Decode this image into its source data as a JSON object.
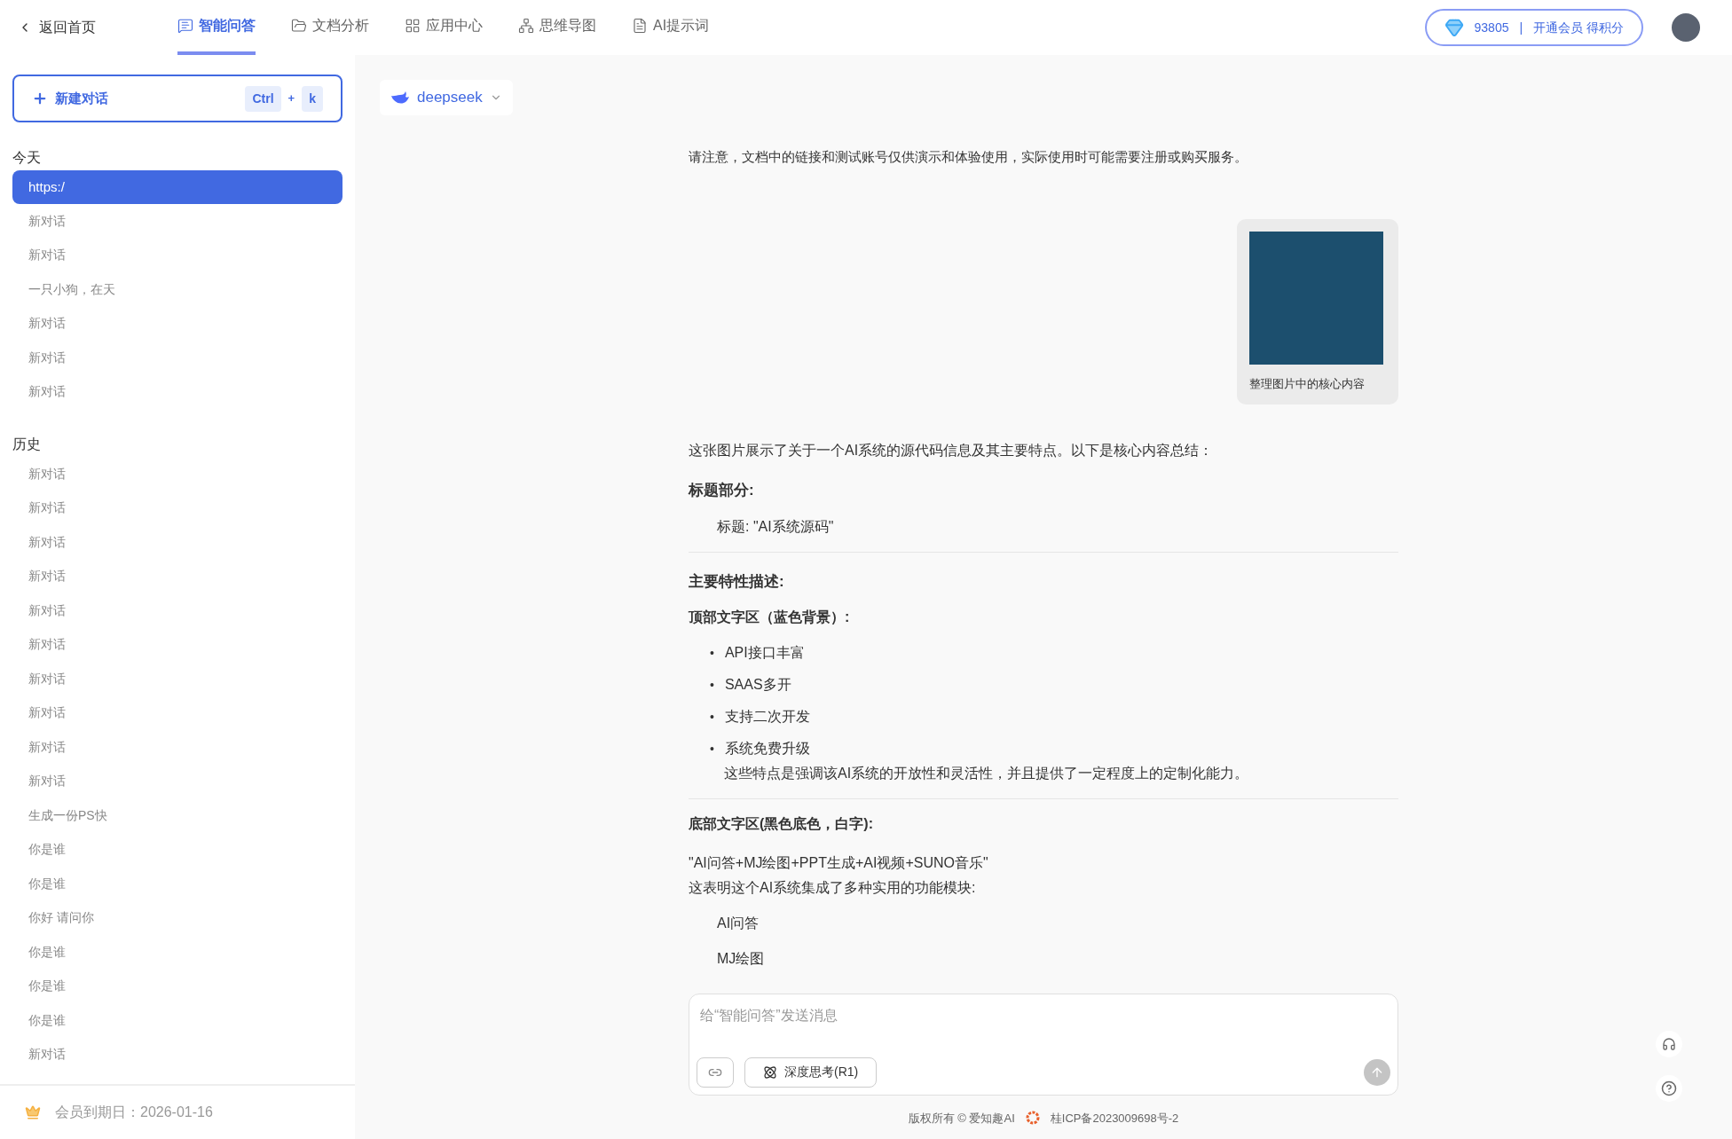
{
  "topbar": {
    "back": "返回首页",
    "tabs": [
      {
        "label": "智能问答",
        "selected": true
      },
      {
        "label": "文档分析",
        "selected": false
      },
      {
        "label": "应用中心",
        "selected": false
      },
      {
        "label": "思维导图",
        "selected": false
      },
      {
        "label": "AI提示词",
        "selected": false
      }
    ],
    "points": "93805",
    "points_separator": "|",
    "member_cta": "开通会员 得积分"
  },
  "sidebar": {
    "new_chat": {
      "label": "新建对话",
      "keys": [
        "Ctrl",
        "+",
        "k"
      ]
    },
    "groups": [
      {
        "title": "今天",
        "items": [
          {
            "label": "https:/",
            "selected": true
          },
          {
            "label": "新对话",
            "selected": false
          },
          {
            "label": "新对话",
            "selected": false
          },
          {
            "label": "一只小狗，在天",
            "selected": false
          },
          {
            "label": "新对话",
            "selected": false
          },
          {
            "label": "新对话",
            "selected": false
          },
          {
            "label": "新对话",
            "selected": false
          }
        ]
      },
      {
        "title": "历史",
        "items": [
          {
            "label": "新对话",
            "selected": false
          },
          {
            "label": "新对话",
            "selected": false
          },
          {
            "label": "新对话",
            "selected": false
          },
          {
            "label": "新对话",
            "selected": false
          },
          {
            "label": "新对话",
            "selected": false
          },
          {
            "label": "新对话",
            "selected": false
          },
          {
            "label": "新对话",
            "selected": false
          },
          {
            "label": "新对话",
            "selected": false
          },
          {
            "label": "新对话",
            "selected": false
          },
          {
            "label": "新对话",
            "selected": false
          },
          {
            "label": "生成一份PS快",
            "selected": false
          },
          {
            "label": "你是谁",
            "selected": false
          },
          {
            "label": "你是谁",
            "selected": false
          },
          {
            "label": "你好 请问你",
            "selected": false
          },
          {
            "label": "你是谁",
            "selected": false
          },
          {
            "label": "你是谁",
            "selected": false
          },
          {
            "label": "你是谁",
            "selected": false
          },
          {
            "label": "新对话",
            "selected": false
          }
        ]
      }
    ],
    "membership": "会员到期日：2026-01-16"
  },
  "model_selector": {
    "label": "deepseek"
  },
  "chat": {
    "notice": "请注意，文档中的链接和测试账号仅供演示和体验使用，实际使用时可能需要注册或购买服务。",
    "user_message": {
      "caption": "整理图片中的核心内容"
    },
    "answer": [
      {
        "kind": "paragraph",
        "text": "这张图片展示了关于一个AI系统的源代码信息及其主要特点。以下是核心内容总结："
      },
      {
        "kind": "heading",
        "text": "标题部分:"
      },
      {
        "kind": "indent",
        "text": "标题: \"AI系统源码\""
      },
      {
        "kind": "divider"
      },
      {
        "kind": "heading",
        "text": "主要特性描述:"
      },
      {
        "kind": "subheading",
        "text": "顶部文字区（蓝色背景）:"
      },
      {
        "kind": "bullets",
        "marker": "•",
        "items": [
          "API接口丰富",
          "SAAS多开",
          "支持二次开发",
          "系统免费升级"
        ]
      },
      {
        "kind": "note",
        "text": "这些特点是强调该AI系统的开放性和灵活性，并且提供了一定程度上的定制化能力。"
      },
      {
        "kind": "divider"
      },
      {
        "kind": "subheading",
        "text": "底部文字区(黑色底色，白字):"
      },
      {
        "kind": "lines",
        "items": [
          "\"AI问答+MJ绘图+PPT生成+AI视频+SUNO音乐\"",
          "这表明这个AI系统集成了多种实用的功能模块:"
        ]
      },
      {
        "kind": "indent",
        "text": "AI问答"
      },
      {
        "kind": "indent",
        "text": "MJ绘图"
      }
    ]
  },
  "composer": {
    "placeholder": "给“智能问答”发送消息",
    "deep_think": "深度思考(R1)"
  },
  "footer": {
    "copyright": "版权所有 © 爱知趣AI",
    "icp": "桂ICP备2023009698号-2"
  }
}
